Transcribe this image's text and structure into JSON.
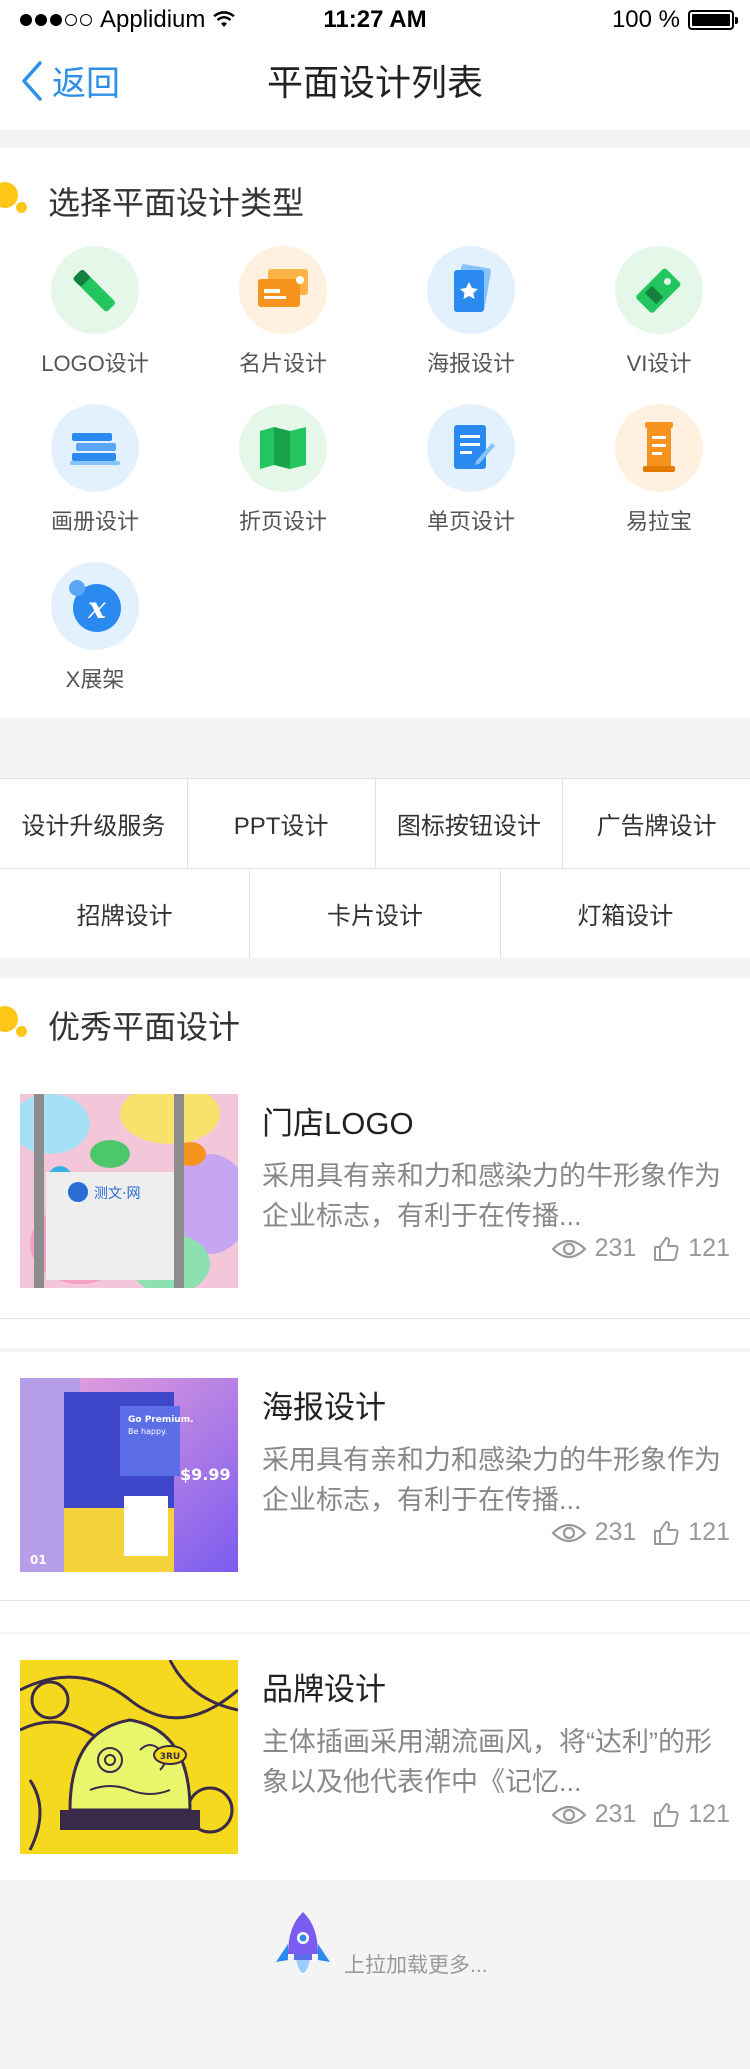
{
  "status_bar": {
    "carrier": "Applidium",
    "time": "11:27 AM",
    "battery": "100 %"
  },
  "nav": {
    "back_label": "返回",
    "title": "平面设计列表"
  },
  "categories_section": {
    "title": "选择平面设计类型",
    "items": [
      {
        "label": "LOGO设计",
        "icon": "marker-icon",
        "bg": "#e4f7e8"
      },
      {
        "label": "名片设计",
        "icon": "business-card-icon",
        "bg": "#fff0e0"
      },
      {
        "label": "海报设计",
        "icon": "poster-icon",
        "bg": "#e3f0fd"
      },
      {
        "label": "VI设计",
        "icon": "tag-icon",
        "bg": "#e4f7e8"
      },
      {
        "label": "画册设计",
        "icon": "album-icon",
        "bg": "#e3f0fd"
      },
      {
        "label": "折页设计",
        "icon": "folded-map-icon",
        "bg": "#e4f7e8"
      },
      {
        "label": "单页设计",
        "icon": "document-edit-icon",
        "bg": "#e3f0fd"
      },
      {
        "label": "易拉宝",
        "icon": "rollup-banner-icon",
        "bg": "#fff0e0"
      },
      {
        "label": "X展架",
        "icon": "x-stand-icon",
        "bg": "#e3f0fd"
      }
    ]
  },
  "tags_row1": [
    "设计升级服务",
    "PPT设计",
    "图标按钮设计",
    "广告牌设计"
  ],
  "tags_row2": [
    "招牌设计",
    "卡片设计",
    "灯箱设计"
  ],
  "featured_section": {
    "title": "优秀平面设计",
    "items": [
      {
        "title": "门店LOGO",
        "desc": "采用具有亲和力和感染力的牛形象作为企业标志，有利于在传播...",
        "views": "231",
        "likes": "121"
      },
      {
        "title": "海报设计",
        "desc": "采用具有亲和力和感染力的牛形象作为企业标志，有利于在传播...",
        "views": "231",
        "likes": "121"
      },
      {
        "title": "品牌设计",
        "desc": "主体插画采用潮流画风，将“达利”的形象以及他代表作中《记忆...",
        "views": "231",
        "likes": "121"
      }
    ]
  },
  "thumb_text": {
    "logo_brand": "测文·网",
    "poster_heading": "Go Premium.",
    "poster_sub": "Be happy.",
    "poster_price": "$9.99",
    "poster_num": "01",
    "brand_stamp": "3RU"
  },
  "footer": {
    "load_more": "上拉加载更多..."
  },
  "colors": {
    "accent": "#2f8fe6",
    "section_dot": "#ffc61a",
    "green": "#22c55e",
    "orange": "#f7941d",
    "blue": "#2b8af0"
  }
}
